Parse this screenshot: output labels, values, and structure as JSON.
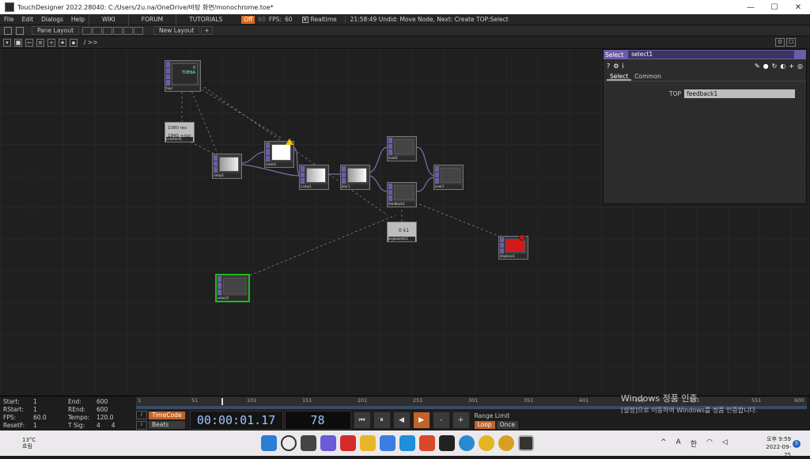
{
  "window": {
    "title": "TouchDesigner 2022.28040: C:/Users/2u.na/OneDrive/바탕 화면/monochrome.toe*",
    "min": "—",
    "max": "☐",
    "close": "✕"
  },
  "menubar": {
    "items": [
      "File",
      "Edit",
      "Dialogs",
      "Help"
    ],
    "wiki": "WIKI",
    "forum": "FORUM",
    "tutorials": "TUTORIALS",
    "fps_badge": "Off",
    "fps_target": "60",
    "fps_label": "FPS:",
    "fps_value": "60",
    "realtime_check": "✕",
    "realtime_label": "Realtime",
    "status": "21:58:49 Undid: Move Node, Next: Create TOP:Select"
  },
  "panebar": {
    "pane_layout": "Pane Layout",
    "new_layout": "New Layout",
    "add": "+"
  },
  "pathbar": {
    "path": "/ >>",
    "btn_a": "0",
    "btn_b": "☐"
  },
  "nodes": [
    {
      "id": "tour",
      "label": "tour",
      "lines": [
        "0",
        "TOENA"
      ]
    },
    {
      "id": "constant",
      "label": "constant1",
      "lines": [
        "1080 res",
        "1840 +nor"
      ]
    },
    {
      "id": "ramp",
      "label": "ramp1"
    },
    {
      "id": "noise",
      "label": "noise1"
    },
    {
      "id": "comp",
      "label": "comp1"
    },
    {
      "id": "level",
      "label": "level1"
    },
    {
      "id": "over",
      "label": "over1"
    },
    {
      "id": "blur",
      "label": "blur1"
    },
    {
      "id": "feedback",
      "label": "feedback1"
    },
    {
      "id": "keyboard",
      "label": "keyboardin1",
      "lines": [
        "0 k1"
      ]
    },
    {
      "id": "displace",
      "label": "displace1"
    },
    {
      "id": "select",
      "label": "select1"
    }
  ],
  "params": {
    "op_type": "Select",
    "op_name": "select1",
    "icons": [
      "?",
      "⚙",
      "i"
    ],
    "tabs": [
      "Select",
      "Common"
    ],
    "top_label": "TOP",
    "top_value": "feedback1"
  },
  "timeline": {
    "start_label": "Start:",
    "start_val": "1",
    "end_label": "End:",
    "end_val": "600",
    "rstart_label": "RStart:",
    "rstart_val": "1",
    "rend_label": "REnd:",
    "rend_val": "600",
    "fps_label": "FPS:",
    "fps_val": "60.0",
    "tempo_label": "Tempo:",
    "tempo_val": "120.0",
    "resetf_label": "ResetF:",
    "resetf_val": "1",
    "tsig_label": "T Sig:",
    "tsig_a": "4",
    "tsig_b": "4",
    "ticks": [
      "1",
      "51",
      "101",
      "151",
      "201",
      "251",
      "301",
      "351",
      "401",
      "451",
      "501",
      "551",
      "600"
    ],
    "timecode": "TimeCode",
    "beats": "Beats",
    "time": "00:00:01.17",
    "frame": "78",
    "range_limit": "Range Limit",
    "loop": "Loop",
    "once": "Once",
    "play_controls": [
      "⏮",
      "⏸",
      "◀",
      "▶",
      "-",
      "+"
    ]
  },
  "watermark": {
    "title": "Windows 정품 인증",
    "sub": "[설정]으로 이동하여 Windows를 정품 인증합니다."
  },
  "taskbar": {
    "temp": "13°C",
    "weather": "흐림",
    "ime_a": "A",
    "ime_b": "한",
    "time": "오후 9:59",
    "date": "2022-09-25",
    "notif": "5"
  }
}
